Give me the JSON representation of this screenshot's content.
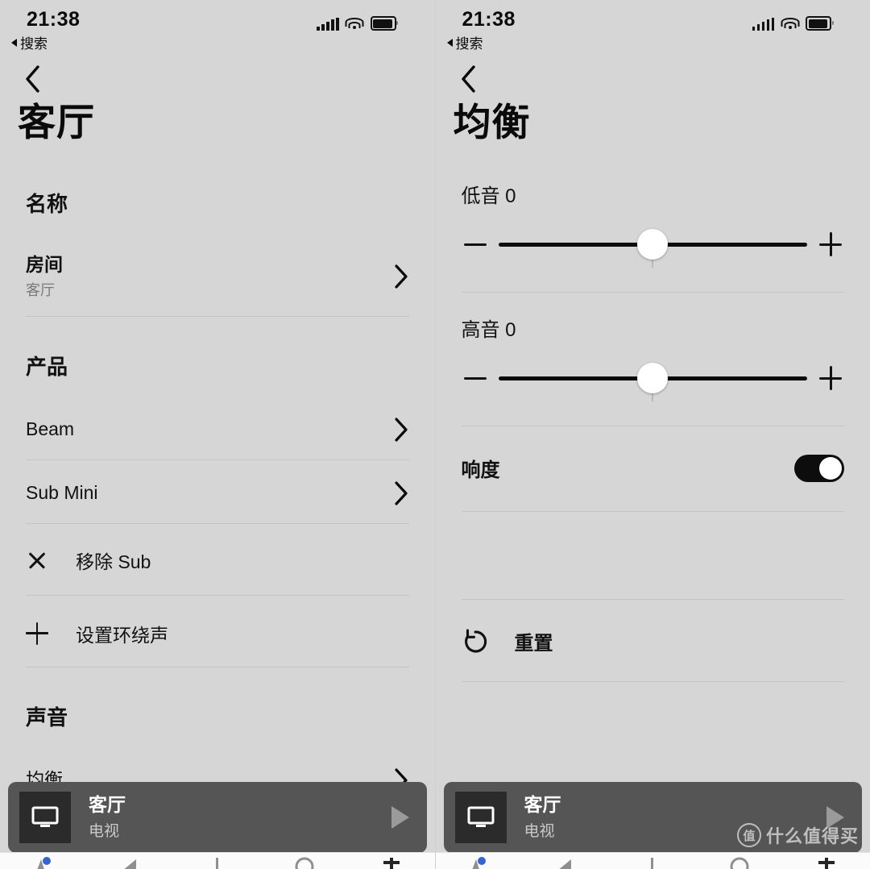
{
  "status_bar": {
    "time": "21:38",
    "back_to_app": "搜索",
    "signal_icon": "signal-bars-icon",
    "wifi_icon": "wifi-icon",
    "battery_icon": "battery-icon"
  },
  "left_panel": {
    "back_icon": "chevron-left-icon",
    "title": "客厅",
    "sections": [
      {
        "heading": "名称"
      },
      {
        "heading": "产品"
      },
      {
        "heading": "声音"
      }
    ],
    "name_section": {
      "heading": "名称",
      "row_title": "房间",
      "row_subtitle": "客厅",
      "chevron": "chevron-right-icon"
    },
    "product_section": {
      "heading": "产品",
      "items": [
        {
          "label": "Beam",
          "chevron": "chevron-right-icon"
        },
        {
          "label": "Sub Mini",
          "chevron": "chevron-right-icon"
        }
      ],
      "actions": [
        {
          "icon": "close-x-icon",
          "label": "移除 Sub"
        },
        {
          "icon": "plus-icon",
          "label": "设置环绕声"
        }
      ]
    },
    "sound_section": {
      "heading": "声音",
      "row_title": "均衡",
      "chevron": "chevron-right-icon"
    }
  },
  "right_panel": {
    "back_icon": "chevron-left-icon",
    "title": "均衡",
    "sliders": [
      {
        "name": "低音",
        "value": "0",
        "label": "低音 0",
        "percent": 50,
        "minus_icon": "minus-icon",
        "plus_icon": "plus-icon"
      },
      {
        "name": "高音",
        "value": "0",
        "label": "高音 0",
        "percent": 50,
        "minus_icon": "minus-icon",
        "plus_icon": "plus-icon"
      }
    ],
    "loudness": {
      "label": "响度",
      "enabled": "开",
      "toggle_icon": "toggle-switch-on"
    },
    "reset": {
      "label": "重置",
      "icon": "reset-arrow-icon"
    }
  },
  "now_playing": {
    "art_icon": "tv-icon",
    "title": "客厅",
    "subtitle": "电视",
    "play_icon": "play-icon"
  },
  "tab_bar": {
    "tabs": [
      {
        "icon": "home-icon"
      },
      {
        "icon": "search-icon"
      },
      {
        "icon": "library-icon"
      },
      {
        "icon": "browse-icon"
      },
      {
        "icon": "settings-icon"
      }
    ]
  },
  "watermark": {
    "mark": "值",
    "text": "什么值得买"
  },
  "colors": {
    "background": "#d6d6d6",
    "now_playing_bar": "#555555",
    "album_art": "#2b2b2b",
    "accent_black": "#0c0c0c",
    "subtitle_gray": "#7b7b7b",
    "divider": "#c3c3c3"
  }
}
